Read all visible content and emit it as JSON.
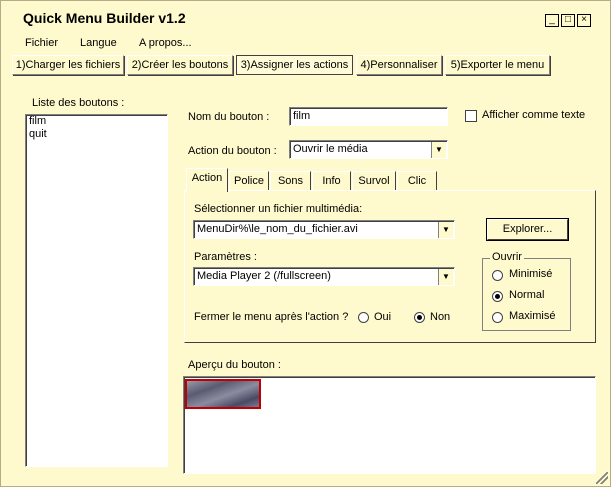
{
  "window": {
    "title": "Quick Menu Builder  v1.2",
    "minimize": "_",
    "maximize": "□",
    "close": "×"
  },
  "menubar": [
    "Fichier",
    "Langue",
    "A propos..."
  ],
  "steps": [
    "1)Charger les fichiers",
    "2)Créer les boutons",
    "3)Assigner les actions",
    "4)Personnaliser",
    "5)Exporter le menu"
  ],
  "active_step": 2,
  "left": {
    "label": "Liste des boutons :",
    "items": [
      "film",
      "quit"
    ]
  },
  "form": {
    "name_label": "Nom du bouton :",
    "name_value": "film",
    "show_text_label": "Afficher comme texte",
    "show_text_checked": false,
    "action_label": "Action du bouton :",
    "action_value": "Ouvrir le média"
  },
  "tabs": [
    "Action",
    "Police",
    "Sons",
    "Info",
    "Survol",
    "Clic"
  ],
  "active_tab": 0,
  "action_panel": {
    "file_label": "Sélectionner un fichier multimédia:",
    "file_value": "MenuDir%\\le_nom_du_fichier.avi",
    "browse_label": "Explorer...",
    "params_label": "Paramètres :",
    "params_value": "Media Player 2 (/fullscreen)",
    "close_question": "Fermer le menu après l'action ?",
    "yes_label": "Oui",
    "no_label": "Non",
    "close_after": "Non",
    "open_group": {
      "title": "Ouvrir",
      "options": [
        "Minimisé",
        "Normal",
        "Maximisé"
      ],
      "selected": "Normal"
    }
  },
  "preview_label": "Aperçu du bouton :"
}
